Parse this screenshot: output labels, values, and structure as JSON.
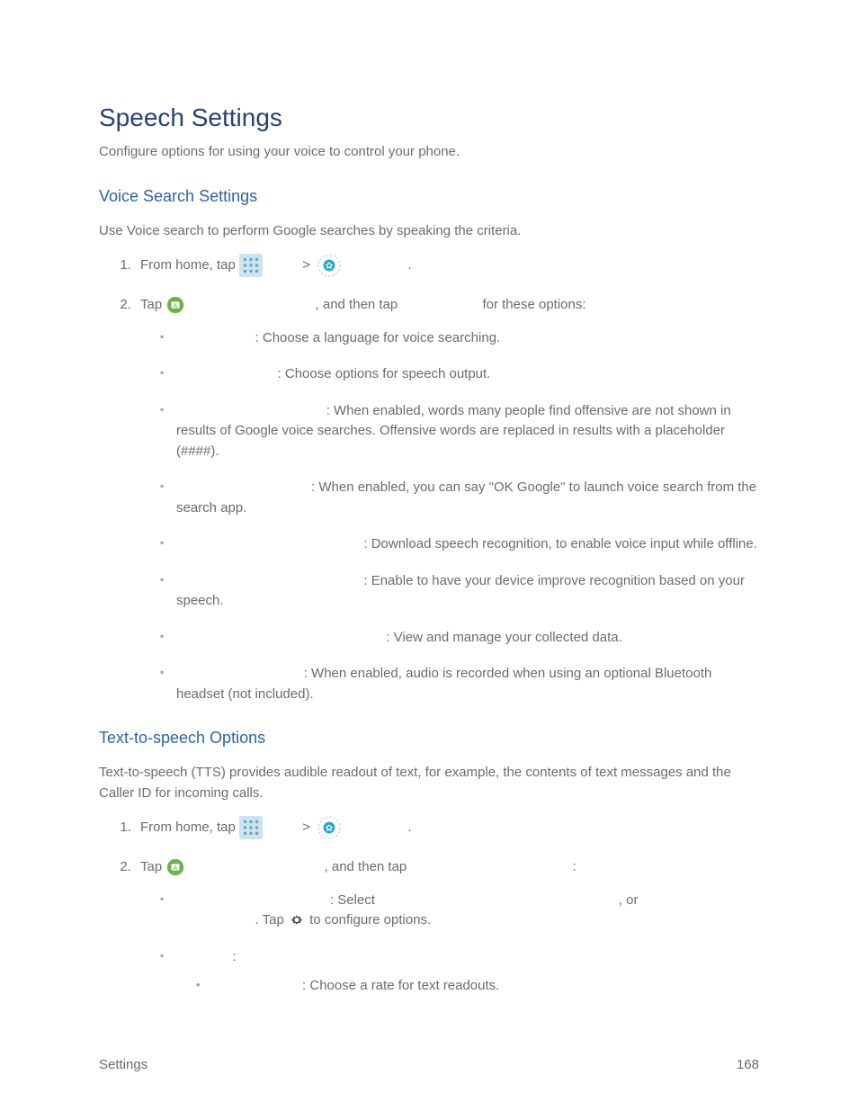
{
  "page": {
    "title": "Speech Settings",
    "subtitle": "Configure options for using your voice to control your phone."
  },
  "voiceSearch": {
    "heading": "Voice Search Settings",
    "intro": "Use Voice search to perform Google searches by speaking the criteria.",
    "step1": {
      "prefix": "From home, tap ",
      "separator": " > ",
      "suffix": "."
    },
    "step2": {
      "prefix": "Tap ",
      "mid": ", and then tap ",
      "suffix": " for these options:"
    },
    "options": {
      "language": ": Choose a language for voice searching.",
      "speechOutput": ": Choose options for speech output.",
      "offensiveWords": ": When enabled, words many people find offensive are not shown in results of Google voice searches. Offensive words are replaced in results with a placeholder (####).",
      "hotword": ": When enabled, you can say \"OK Google\" to launch voice search from the search app.",
      "offline": ": Download speech recognition, to enable voice input while offline.",
      "personalized": ": Enable to have your device improve recognition based on your speech.",
      "dashboard": ": View and manage your collected data.",
      "bluetooth": ": When enabled, audio is recorded when using an optional Bluetooth headset (not included)."
    },
    "optionLabelGaps": {
      "language": "                     ",
      "speechOutput": "                           ",
      "offensiveWords": "                                        ",
      "hotword": "                                    ",
      "offline": "                                                  ",
      "personalized": "                                                  ",
      "dashboard": "                                                        ",
      "bluetooth": "                                  "
    }
  },
  "tts": {
    "heading": "Text-to-speech Options",
    "intro": "Text-to-speech (TTS) provides audible readout of text, for example, the contents of text messages and the Caller ID for incoming calls.",
    "step1": {
      "prefix": "From home, tap ",
      "separator": " > ",
      "suffix": "."
    },
    "step2": {
      "prefix": "Tap ",
      "mid": ", and then tap ",
      "suffix": ":"
    },
    "engine": {
      "prefix": ": Select ",
      "mid": ", or ",
      "tapPrefix": ". Tap ",
      "tapSuffix": " to configure options."
    },
    "generalLabel": ":",
    "speechRate": ": Choose a rate for text readouts."
  },
  "footer": {
    "left": "Settings",
    "right": "168"
  }
}
